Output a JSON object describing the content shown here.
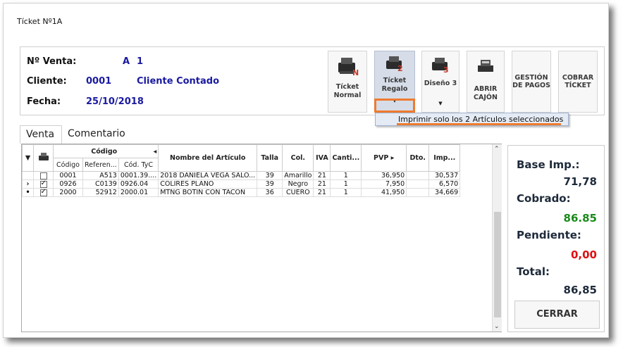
{
  "window_title": "Tícket Nº1A",
  "info": {
    "venta_label": "Nº Venta:",
    "venta_serie": "A",
    "venta_num": "1",
    "cliente_label": "Cliente:",
    "cliente_code": "0001",
    "cliente_name": "Cliente Contado",
    "fecha_label": "Fecha:",
    "fecha_val": "25/10/2018"
  },
  "toolbar": [
    {
      "line1": "Tícket",
      "line2": "Normal",
      "icon": "printer-n-icon"
    },
    {
      "line1": "Tícket",
      "line2": "Regalo",
      "icon": "printer-2-icon"
    },
    {
      "line1": "Diseño 3",
      "line2": "",
      "icon": "printer-3-icon"
    },
    {
      "line1": "ABRIR",
      "line2": "CAJÓN",
      "icon": "cash-register-icon"
    },
    {
      "line1": "GESTIÓN",
      "line2": "DE PAGOS",
      "icon": ""
    },
    {
      "line1": "COBRAR",
      "line2": "TÍCKET",
      "icon": ""
    }
  ],
  "dropdown_item": "Imprimir solo los 2 Artículos seleccionados",
  "tabs": [
    "Venta",
    "Comentario"
  ],
  "grid": {
    "group_header": "Código",
    "columns": [
      "Código",
      "Referen...",
      "Cód. TyC",
      "Nombre del Artículo",
      "Talla",
      "Col.",
      "IVA",
      "Canti...",
      "PVP",
      "Dto.",
      "Imp..."
    ],
    "rows": [
      {
        "marker": "",
        "checked": false,
        "codigo": "0001",
        "ref": "A513",
        "tyc": "0001.39....",
        "nombre": "2018 DANIELA VEGA SALO...",
        "talla": "39",
        "col": "Amarillo",
        "iva": "21",
        "cant": "1",
        "pvp": "36,950",
        "dto": "",
        "imp": "30,537"
      },
      {
        "marker": "›",
        "checked": true,
        "codigo": "0926",
        "ref": "C0139",
        "tyc": "0926.04",
        "nombre": "COLIRES PLANO",
        "talla": "39",
        "col": "Negro",
        "iva": "21",
        "cant": "1",
        "pvp": "7,950",
        "dto": "",
        "imp": "6,570"
      },
      {
        "marker": "•",
        "checked": true,
        "codigo": "2000",
        "ref": "52912",
        "tyc": "2000.01",
        "nombre": "MTNG BOTIN CON TACON",
        "talla": "36",
        "col": "CUERO",
        "iva": "21",
        "cant": "1",
        "pvp": "41,950",
        "dto": "",
        "imp": "34,669"
      }
    ]
  },
  "summary": {
    "base_label": "Base Imp.:",
    "base_val": "71,78",
    "cobrado_label": "Cobrado:",
    "cobrado_val": "86.85",
    "pendiente_label": "Pendiente:",
    "pendiente_val": "0,00",
    "total_label": "Total:",
    "total_val": "86,85",
    "close_label": "CERRAR"
  },
  "colors": {
    "accent_orange": "#ef7a2e",
    "cobrado_green": "#1a8a1a",
    "pendiente_red": "#e01010",
    "info_blue": "#1a1aa0"
  }
}
